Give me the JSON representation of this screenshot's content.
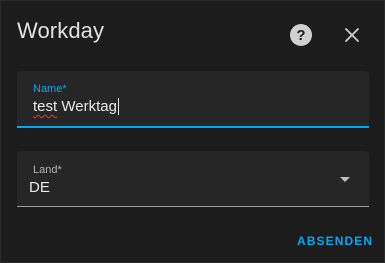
{
  "dialog": {
    "title": "Workday",
    "help_icon": "help-circle-icon",
    "help_glyph": "?",
    "close_icon": "close-icon"
  },
  "form": {
    "name": {
      "label": "Name*",
      "value_first": "test",
      "value_rest": " Werktag",
      "focused": true
    },
    "land": {
      "label": "Land*",
      "value": "DE",
      "dropdown_icon": "dropdown-arrow-icon"
    }
  },
  "actions": {
    "submit_label": "ABSENDEN"
  },
  "colors": {
    "background": "#1c1c1c",
    "field_background": "#262626",
    "accent": "#03a9f4",
    "text": "#e1e1e1",
    "spellcheck_underline": "#e53935"
  }
}
